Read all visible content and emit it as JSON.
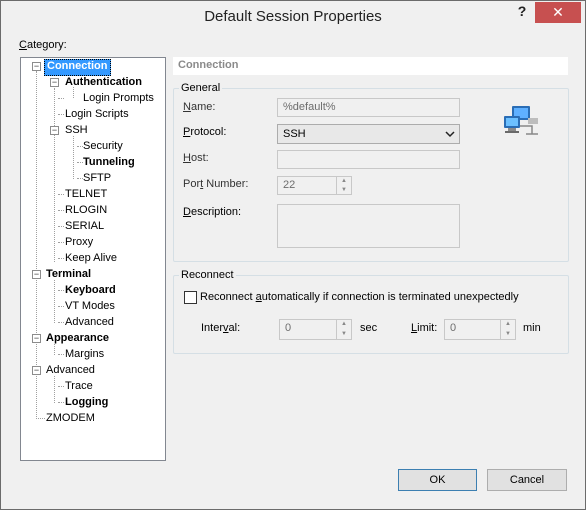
{
  "window": {
    "title": "Default Session Properties",
    "help_label": "?",
    "close_label": "✕"
  },
  "category_label": "Category:",
  "tree": {
    "connection": "Connection",
    "authentication": "Authentication",
    "login_prompts": "Login Prompts",
    "login_scripts": "Login Scripts",
    "ssh": "SSH",
    "security": "Security",
    "tunneling": "Tunneling",
    "sftp": "SFTP",
    "telnet": "TELNET",
    "rlogin": "RLOGIN",
    "serial": "SERIAL",
    "proxy": "Proxy",
    "keep_alive": "Keep Alive",
    "terminal": "Terminal",
    "keyboard": "Keyboard",
    "vt_modes": "VT Modes",
    "advanced_term": "Advanced",
    "appearance": "Appearance",
    "margins": "Margins",
    "advanced": "Advanced",
    "trace": "Trace",
    "logging": "Logging",
    "zmodem": "ZMODEM",
    "expander_minus": "−"
  },
  "header": {
    "title": "Connection"
  },
  "general": {
    "group_title": "General",
    "name_label": "Name:",
    "name_value": "%default%",
    "protocol_label": "Protocol:",
    "protocol_value": "SSH",
    "host_label": "Host:",
    "host_value": "",
    "port_label": "Port Number:",
    "port_value": "22",
    "description_label": "Description:",
    "description_value": ""
  },
  "reconnect": {
    "group_title": "Reconnect",
    "checkbox_label": "Reconnect automatically if connection is terminated unexpectedly",
    "checked": false,
    "interval_label": "Interval:",
    "interval_value": "0",
    "interval_unit": "sec",
    "limit_label": "Limit:",
    "limit_value": "0",
    "limit_unit": "min"
  },
  "buttons": {
    "ok": "OK",
    "cancel": "Cancel"
  },
  "icons": {
    "network": "network-computers-icon",
    "dropdown": "chevron-down-icon"
  }
}
